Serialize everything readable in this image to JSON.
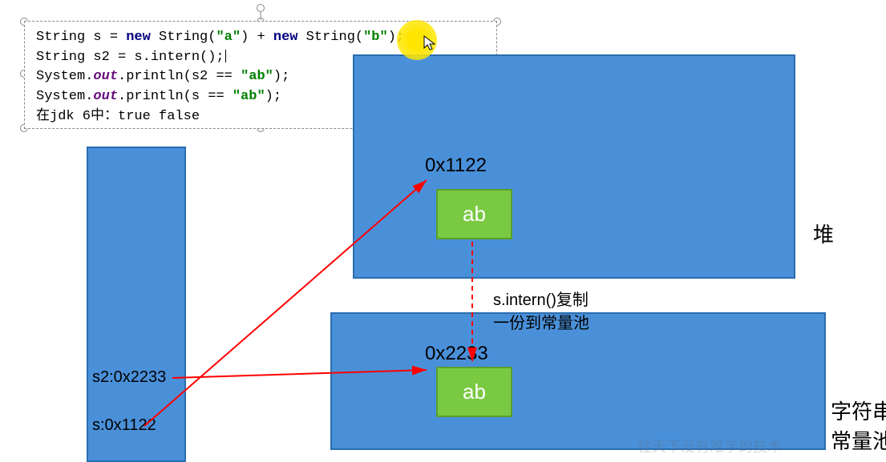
{
  "code": {
    "line1_pre": "String s = ",
    "line1_new1": "new",
    "line1_mid1": " String(",
    "line1_str1": "\"a\"",
    "line1_mid2": ") + ",
    "line1_new2": "new",
    "line1_mid3": " String(",
    "line1_str2": "\"b\"",
    "line1_end": ");",
    "line2": "String s2 = s.intern();",
    "line3_pre": "System.",
    "line3_out": "out",
    "line3_mid": ".println(s2 == ",
    "line3_str": "\"ab\"",
    "line3_end": ");",
    "line4_pre": "System.",
    "line4_out": "out",
    "line4_mid": ".println(s == ",
    "line4_str": "\"ab\"",
    "line4_end": ");",
    "line5": "在jdk 6中：true  false"
  },
  "heap": {
    "address": "0x1122",
    "value": "ab",
    "label": "堆"
  },
  "pool": {
    "address": "0x2233",
    "value": "ab",
    "label": "字符串常量池"
  },
  "stack": {
    "s2": "s2:0x2233",
    "s": "s:0x1122"
  },
  "intern_note_l1": "s.intern()复制",
  "intern_note_l2": "一份到常量池",
  "watermark": "往天下没有难学的技术"
}
